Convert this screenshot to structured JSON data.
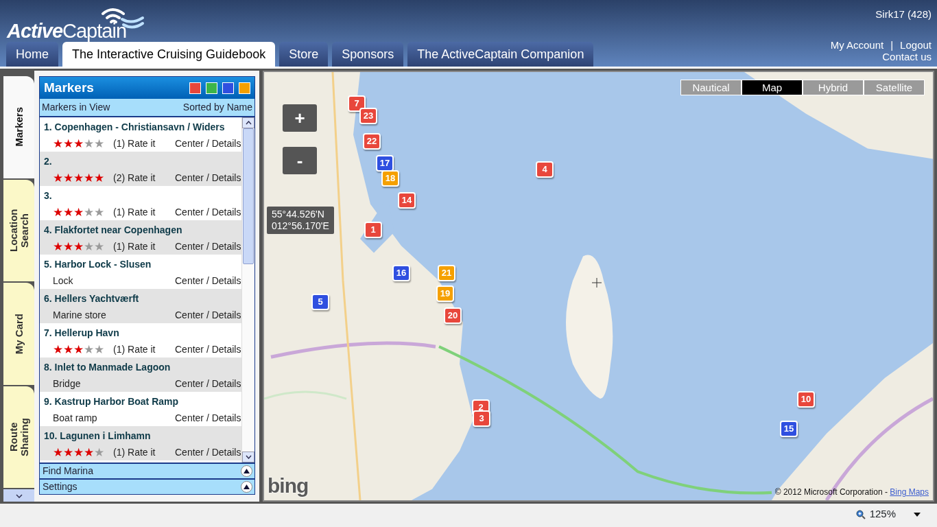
{
  "header": {
    "logo": {
      "part1": "Active",
      "part2": "Captain"
    },
    "user": "Sirk17 (428)",
    "links": [
      {
        "label": "My Account"
      },
      {
        "label": "Logout"
      },
      {
        "label": "Contact us"
      }
    ],
    "separator": "|"
  },
  "nav_tabs": [
    {
      "label": "Home",
      "selected": false
    },
    {
      "label": "The Interactive Cruising Guidebook",
      "selected": true
    },
    {
      "label": "Store",
      "selected": false
    },
    {
      "label": "Sponsors",
      "selected": false
    },
    {
      "label": "The ActiveCaptain Companion",
      "selected": false
    }
  ],
  "side_tabs": [
    {
      "label": "Markers",
      "selected": true
    },
    {
      "label": "Location Search",
      "selected": false
    },
    {
      "label": "My Card",
      "selected": false
    },
    {
      "label": "Route Sharing",
      "selected": false
    }
  ],
  "markers_panel": {
    "title": "Markers",
    "filters": [
      {
        "color": "#e8473c"
      },
      {
        "color": "#3cb54a"
      },
      {
        "color": "#2f4fe0"
      },
      {
        "color": "#f5a000"
      }
    ],
    "subheader_left": "Markers in View",
    "subheader_right": "Sorted by Name",
    "items": [
      {
        "title": "1. Copenhagen - Christiansavn / Widers",
        "kind": "rated",
        "stars": 3,
        "count": "(1)",
        "rate": "Rate it",
        "action": "Center / Details"
      },
      {
        "title": "2.",
        "kind": "rated",
        "stars": 5,
        "count": "(2)",
        "rate": "Rate it",
        "action": "Center / Details"
      },
      {
        "title": "3.",
        "kind": "rated",
        "stars": 3,
        "count": "(1)",
        "rate": "Rate it",
        "action": "Center / Details"
      },
      {
        "title": "4. Flakfortet near Copenhagen",
        "kind": "rated",
        "stars": 3,
        "count": "(1)",
        "rate": "Rate it",
        "action": "Center / Details"
      },
      {
        "title": "5. Harbor Lock - Slusen",
        "kind": "category",
        "category": "Lock",
        "action": "Center / Details"
      },
      {
        "title": "6. Hellers Yachtværft",
        "kind": "category",
        "category": "Marine store",
        "action": "Center / Details"
      },
      {
        "title": "7. Hellerup Havn",
        "kind": "rated",
        "stars": 3,
        "count": "(1)",
        "rate": "Rate it",
        "action": "Center / Details"
      },
      {
        "title": "8. Inlet to Manmade Lagoon",
        "kind": "category",
        "category": "Bridge",
        "action": "Center / Details"
      },
      {
        "title": "9. Kastrup Harbor Boat Ramp",
        "kind": "category",
        "category": "Boat ramp",
        "action": "Center / Details"
      },
      {
        "title": "10. Lagunen i Limhamn",
        "kind": "rated",
        "stars": 4,
        "count": "(1)",
        "rate": "Rate it",
        "action": "Center / Details"
      }
    ],
    "sections": [
      {
        "label": "Find Marina"
      },
      {
        "label": "Settings"
      }
    ]
  },
  "map": {
    "map_types": [
      {
        "label": "Nautical",
        "selected": false
      },
      {
        "label": "Map",
        "selected": true
      },
      {
        "label": "Hybrid",
        "selected": false
      },
      {
        "label": "Satellite",
        "selected": false
      }
    ],
    "zoom_in": "+",
    "zoom_out": "-",
    "coordinates": [
      "55°44.526'N",
      "012°56.170'E"
    ],
    "pins": [
      {
        "label": "7",
        "color": "#e8473c"
      },
      {
        "label": "23",
        "color": "#e8473c"
      },
      {
        "label": "22",
        "color": "#e8473c"
      },
      {
        "label": "17",
        "color": "#2f4fe0"
      },
      {
        "label": "18",
        "color": "#f5a000"
      },
      {
        "label": "14",
        "color": "#e8473c"
      },
      {
        "label": "4",
        "color": "#e8473c"
      },
      {
        "label": "1",
        "color": "#e8473c"
      },
      {
        "label": "16",
        "color": "#2f4fe0"
      },
      {
        "label": "21",
        "color": "#f5a000"
      },
      {
        "label": "19",
        "color": "#f5a000"
      },
      {
        "label": "20",
        "color": "#e8473c"
      },
      {
        "label": "5",
        "color": "#2f4fe0"
      },
      {
        "label": "2",
        "color": "#e8473c"
      },
      {
        "label": "3",
        "color": "#e8473c"
      },
      {
        "label": "10",
        "color": "#e8473c"
      },
      {
        "label": "15",
        "color": "#2f4fe0"
      }
    ],
    "logo": "bing",
    "copyright": "© 2012 Microsoft Corporation - ",
    "copyright_link": "Bing Maps"
  },
  "status_bar": {
    "zoom": "125%"
  }
}
